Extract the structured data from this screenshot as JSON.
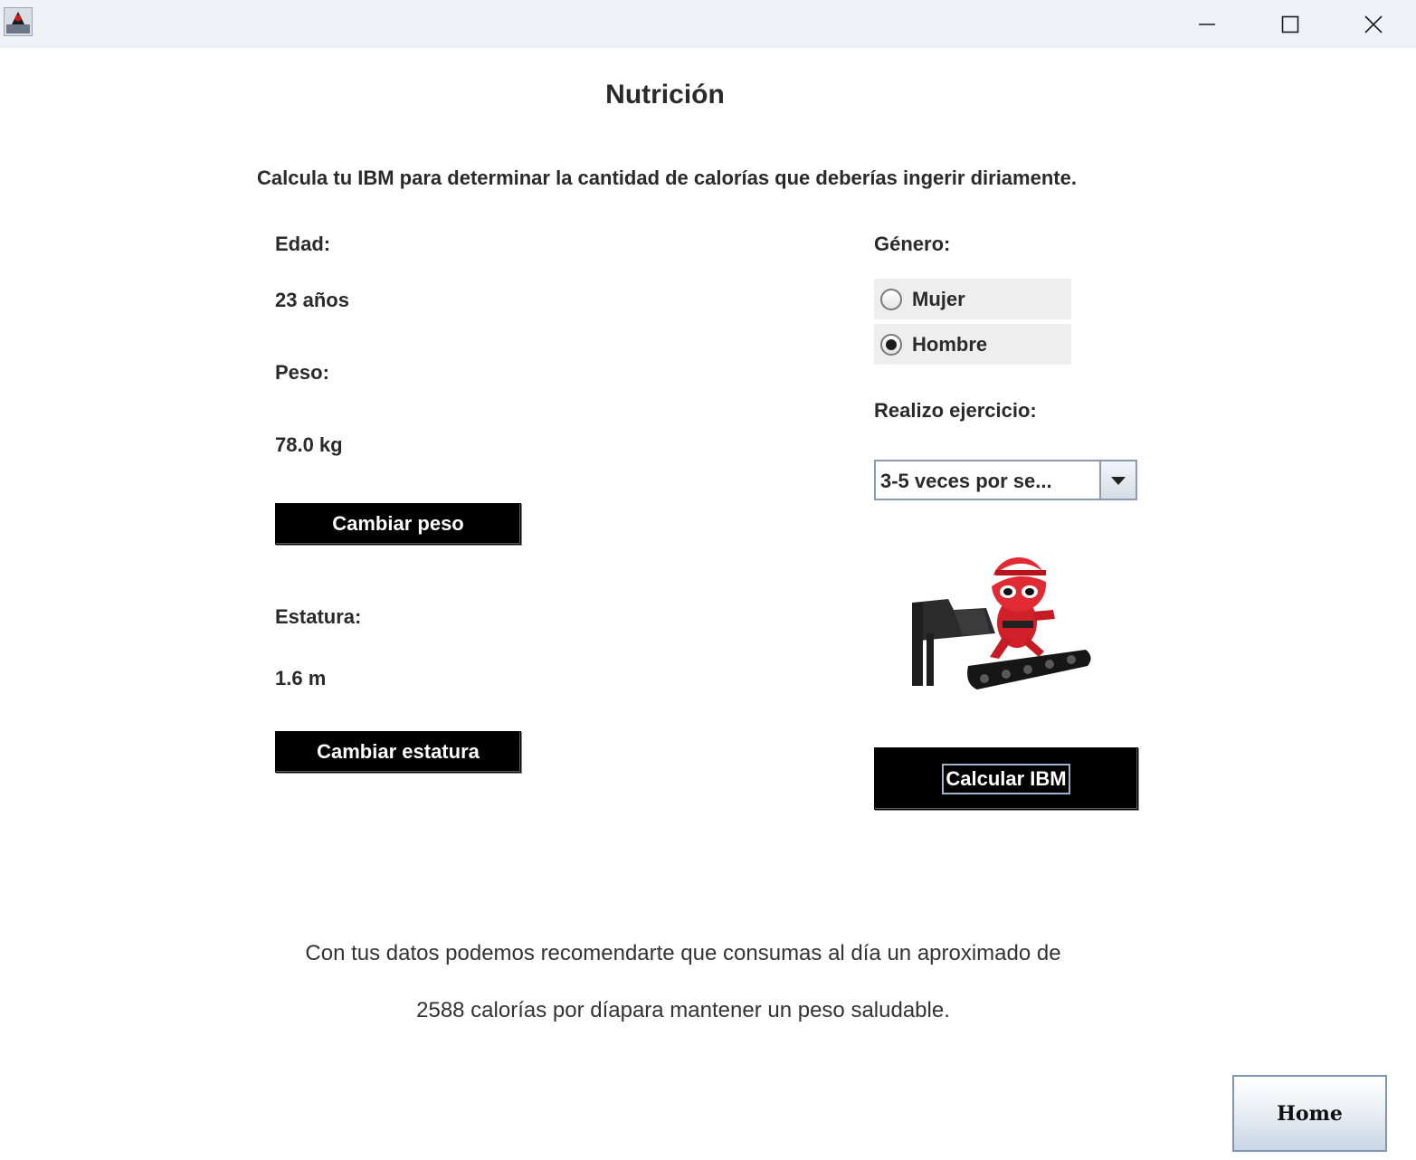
{
  "window": {
    "icon": "java-duke-icon",
    "controls": [
      "minimize-icon",
      "maximize-icon",
      "close-icon"
    ]
  },
  "header": {
    "title": "Nutrición",
    "subtitle": "Calcula tu IBM para determinar la cantidad de calorías que deberías ingerir diriamente."
  },
  "left": {
    "age_label": "Edad:",
    "age_value": "23 años",
    "weight_label": "Peso:",
    "weight_value": "78.0 kg",
    "change_weight_button": "Cambiar peso",
    "height_label": "Estatura:",
    "height_value": "1.6 m",
    "change_height_button": "Cambiar estatura"
  },
  "right": {
    "gender_label": "Género:",
    "gender_options": [
      {
        "label": "Mujer",
        "checked": false
      },
      {
        "label": "Hombre",
        "checked": true
      }
    ],
    "exercise_label": "Realizo ejercicio:",
    "exercise_selected": "3-5 veces por se...",
    "illustration": "treadmill-runner-illustration",
    "calculate_button": "Calcular IBM"
  },
  "result": {
    "line1": "Con tus datos podemos recomendarte que consumas al día un aproximado de",
    "line2": "2588 calorías por díapara mantener un peso saludable."
  },
  "footer": {
    "home_button": "Home"
  },
  "colors": {
    "titlebar": "#eef1f6",
    "button_black": "#000000",
    "radio_bg": "#eeeeee",
    "select_border": "#8a9bb0",
    "home_gradient_end": "#c9d6e4"
  }
}
